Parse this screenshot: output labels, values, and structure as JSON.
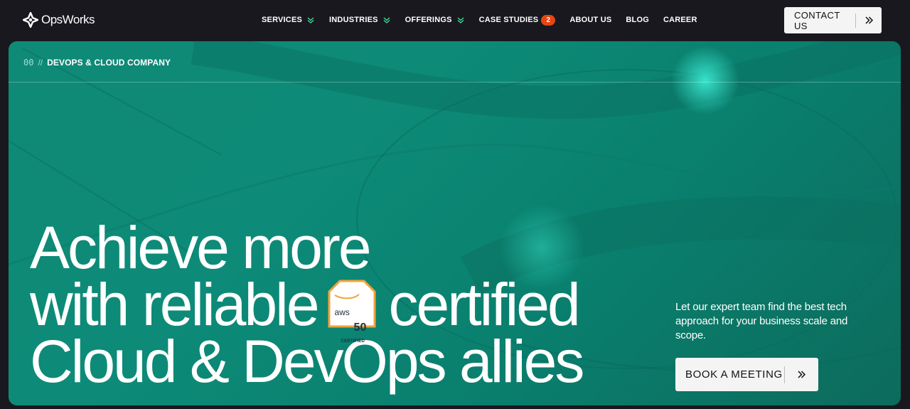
{
  "header": {
    "logo_text": "OpsWorks",
    "logo_icon": "opsworks-mark-icon",
    "nav": [
      {
        "label": "SERVICES",
        "has_dropdown": true
      },
      {
        "label": "INDUSTRIES",
        "has_dropdown": true
      },
      {
        "label": "OFFERINGS",
        "has_dropdown": true
      },
      {
        "label": "CASE STUDIES",
        "badge": "2"
      },
      {
        "label": "ABOUT US"
      },
      {
        "label": "BLOG"
      },
      {
        "label": "CAREER"
      }
    ],
    "contact_label": "CONTACT US",
    "contact_icon": "double-chevron-right-icon"
  },
  "hero": {
    "kicker_number": "00",
    "kicker_separator": "//",
    "kicker_text": "DEVOPS & CLOUD COMPANY",
    "headline": {
      "line1": "Achieve more",
      "line2_before": "with reliable",
      "line2_after": "certified",
      "line3": "Cloud & DevOps allies"
    },
    "aws_badge": {
      "logo": "aws",
      "number": "50",
      "label": "CERTIFIED"
    },
    "lead_text": "Let our expert team find the best tech approach for your business scale and scope.",
    "cta_label": "BOOK A MEETING",
    "cta_icon": "double-chevron-right-icon"
  },
  "colors": {
    "page_bg": "#19181f",
    "hero_teal": "#0d8b78",
    "badge_orange": "#e64512",
    "nav_chevron": "#3ddc97",
    "button_bg": "#f4f4f4",
    "aws_badge_border": "#f2a33a"
  }
}
